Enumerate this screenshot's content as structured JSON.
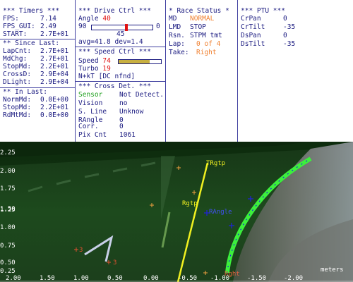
{
  "timers": {
    "title": "*** Timers ***",
    "rows": [
      {
        "label": "FPS:",
        "value": "7.14"
      },
      {
        "label": "FPS_GUI:",
        "value": "2.49"
      },
      {
        "label": "START:",
        "value": "2.7E+01"
      }
    ],
    "since_last_title": "** Since Last:",
    "since_last": [
      {
        "label": "LapCnt:",
        "value": "2.7E+01"
      },
      {
        "label": "MdChg:",
        "value": "2.7E+01"
      },
      {
        "label": "StopMd:",
        "value": "2.2E+01"
      },
      {
        "label": "CrossD:",
        "value": "2.9E+04"
      },
      {
        "label": "DLight:",
        "value": "2.9E+04"
      }
    ],
    "in_last_title": "** In Last:",
    "in_last": [
      {
        "label": "NormMd:",
        "value": "0.0E+00"
      },
      {
        "label": "StopMd:",
        "value": "2.2E+01"
      },
      {
        "label": "RdMtMd:",
        "value": "0.0E+00"
      }
    ]
  },
  "drive": {
    "title": "*** Drive Ctrl ***",
    "angle_label": "Angle",
    "angle_value": "40",
    "slider_min": "90",
    "slider_max": "0",
    "slider_position": 0.55,
    "slider_center": "45",
    "avg_text": "avg=41.8",
    "dev_text": "dev=1.4"
  },
  "speed": {
    "title": "*** Speed Ctrl ***",
    "speed_label": "Speed",
    "speed_value": "74",
    "speed_fraction": 0.74,
    "turbo_label": "Turbo",
    "turbo_value": "19",
    "nkt_text": "N+kT [DC nfnd]"
  },
  "cross": {
    "title": "*** Cross Det. ***",
    "rows": [
      {
        "label": "Sensor",
        "value": "Not Detect."
      },
      {
        "label": "Vision",
        "value": "no"
      },
      {
        "label": "S. Line",
        "value": "Unknow"
      },
      {
        "label": "RAngle",
        "value": "0"
      },
      {
        "label": "Corr.",
        "value": "0"
      },
      {
        "label": "Pix Cnt",
        "value": "1061"
      }
    ]
  },
  "race": {
    "title": "* Race Status *",
    "rows": [
      {
        "label": "MD",
        "value": "NORMAL",
        "color": "#f08030"
      },
      {
        "label": "LMD",
        "value": "STOP",
        "color": "#1a1a80"
      },
      {
        "label": "Rsn.",
        "value": "STPM tmt",
        "color": "#1a1a80"
      },
      {
        "label": "Lap:",
        "value": "0 of 4",
        "color": "#f08030"
      },
      {
        "label": "Take:",
        "value": "Right",
        "color": "#f08030"
      }
    ]
  },
  "ptu": {
    "title": "*** PTU ***",
    "rows": [
      {
        "label": "CrPan",
        "value": "0"
      },
      {
        "label": "CrTilt",
        "value": "-35"
      },
      {
        "label": "DsPan",
        "value": "0"
      },
      {
        "label": "DsTilt",
        "value": "-35"
      }
    ]
  },
  "view": {
    "y_ticks": [
      "2.25",
      "2.00",
      "1.75",
      "1.50",
      "1.25",
      "1.00",
      "0.75",
      "0.50",
      "0.25"
    ],
    "x_ticks": [
      "2.00",
      "1.50",
      "1.00",
      "0.50",
      "0.00",
      "-0.50",
      "-1.00",
      "-1.50",
      "-2.00"
    ],
    "unit_label": "meters",
    "markers": {
      "rgtp_top": "TRgtp",
      "rgtp": "Rgtp",
      "rangle": "RAngle",
      "rght": "Rght",
      "m3a": "3",
      "m3b": "3"
    }
  },
  "colors": {
    "text": "#1a1a80",
    "accent_red": "#e01010",
    "accent_orange": "#f08030",
    "sensor_green": "#20a020",
    "track_green": "#3cf03c",
    "track_blue": "#2020e0",
    "guide_yellow": "#f0f020"
  }
}
